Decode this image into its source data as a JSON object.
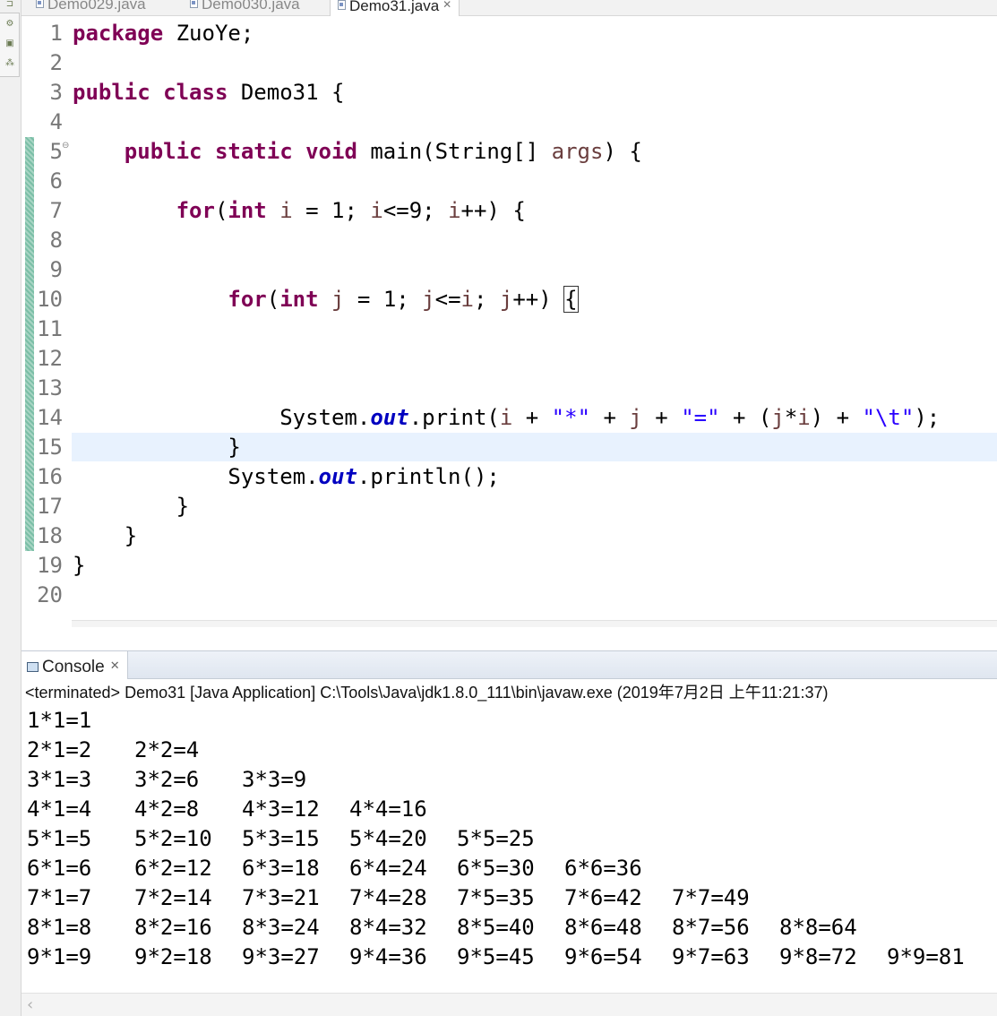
{
  "editor_tabs": [
    {
      "label": "Demo029.java",
      "active": false
    },
    {
      "label": "Demo030.java",
      "active": false
    },
    {
      "label": "Demo31.java",
      "active": true
    }
  ],
  "code_lines": [
    {
      "num": "1",
      "tokens": [
        {
          "t": "kw",
          "v": "package"
        },
        {
          "t": "",
          "v": " ZuoYe;"
        }
      ]
    },
    {
      "num": "2",
      "tokens": []
    },
    {
      "num": "3",
      "tokens": [
        {
          "t": "kw",
          "v": "public"
        },
        {
          "t": "",
          "v": " "
        },
        {
          "t": "kw",
          "v": "class"
        },
        {
          "t": "",
          "v": " Demo31 {"
        }
      ]
    },
    {
      "num": "4",
      "tokens": []
    },
    {
      "num": "5",
      "fold": true,
      "tokens": [
        {
          "t": "",
          "v": "    "
        },
        {
          "t": "kw",
          "v": "public"
        },
        {
          "t": "",
          "v": " "
        },
        {
          "t": "kw",
          "v": "static"
        },
        {
          "t": "",
          "v": " "
        },
        {
          "t": "kw",
          "v": "void"
        },
        {
          "t": "",
          "v": " main(String[] "
        },
        {
          "t": "var",
          "v": "args"
        },
        {
          "t": "",
          "v": ") {"
        }
      ]
    },
    {
      "num": "6",
      "tokens": []
    },
    {
      "num": "7",
      "tokens": [
        {
          "t": "",
          "v": "        "
        },
        {
          "t": "kw",
          "v": "for"
        },
        {
          "t": "",
          "v": "("
        },
        {
          "t": "kw",
          "v": "int"
        },
        {
          "t": "",
          "v": " "
        },
        {
          "t": "var",
          "v": "i"
        },
        {
          "t": "",
          "v": " = 1; "
        },
        {
          "t": "var",
          "v": "i"
        },
        {
          "t": "",
          "v": "<=9; "
        },
        {
          "t": "var",
          "v": "i"
        },
        {
          "t": "",
          "v": "++) {"
        }
      ]
    },
    {
      "num": "8",
      "tokens": []
    },
    {
      "num": "9",
      "tokens": []
    },
    {
      "num": "10",
      "tokens": [
        {
          "t": "",
          "v": "            "
        },
        {
          "t": "kw",
          "v": "for"
        },
        {
          "t": "",
          "v": "("
        },
        {
          "t": "kw",
          "v": "int"
        },
        {
          "t": "",
          "v": " "
        },
        {
          "t": "var",
          "v": "j"
        },
        {
          "t": "",
          "v": " = 1; "
        },
        {
          "t": "var",
          "v": "j"
        },
        {
          "t": "",
          "v": "<="
        },
        {
          "t": "var",
          "v": "i"
        },
        {
          "t": "",
          "v": "; "
        },
        {
          "t": "var",
          "v": "j"
        },
        {
          "t": "",
          "v": "++) "
        },
        {
          "t": "match",
          "v": "{"
        }
      ]
    },
    {
      "num": "11",
      "tokens": []
    },
    {
      "num": "12",
      "tokens": []
    },
    {
      "num": "13",
      "tokens": []
    },
    {
      "num": "14",
      "tokens": [
        {
          "t": "",
          "v": "                System."
        },
        {
          "t": "fld",
          "v": "out"
        },
        {
          "t": "",
          "v": ".print("
        },
        {
          "t": "var",
          "v": "i"
        },
        {
          "t": "",
          "v": " + "
        },
        {
          "t": "str",
          "v": "\"*\""
        },
        {
          "t": "",
          "v": " + "
        },
        {
          "t": "var",
          "v": "j"
        },
        {
          "t": "",
          "v": " + "
        },
        {
          "t": "str",
          "v": "\"=\""
        },
        {
          "t": "",
          "v": " + ("
        },
        {
          "t": "var",
          "v": "j"
        },
        {
          "t": "",
          "v": "*"
        },
        {
          "t": "var",
          "v": "i"
        },
        {
          "t": "",
          "v": ") + "
        },
        {
          "t": "str",
          "v": "\"\\t\""
        },
        {
          "t": "",
          "v": ");"
        }
      ]
    },
    {
      "num": "15",
      "tokens": [
        {
          "t": "",
          "v": "            }"
        }
      ]
    },
    {
      "num": "16",
      "tokens": [
        {
          "t": "",
          "v": "            System."
        },
        {
          "t": "fld",
          "v": "out"
        },
        {
          "t": "",
          "v": ".println();"
        }
      ]
    },
    {
      "num": "17",
      "tokens": [
        {
          "t": "",
          "v": "        }"
        }
      ]
    },
    {
      "num": "18",
      "tokens": [
        {
          "t": "",
          "v": "    }"
        }
      ]
    },
    {
      "num": "19",
      "tokens": [
        {
          "t": "",
          "v": "}"
        }
      ]
    },
    {
      "num": "20",
      "tokens": []
    }
  ],
  "console": {
    "tab_label": "Console",
    "status": "<terminated> Demo31 [Java Application] C:\\Tools\\Java\\jdk1.8.0_111\\bin\\javaw.exe (2019年7月2日 上午11:21:37)",
    "output_lines": [
      [
        "1*1=1"
      ],
      [
        "2*1=2",
        "2*2=4"
      ],
      [
        "3*1=3",
        "3*2=6",
        "3*3=9"
      ],
      [
        "4*1=4",
        "4*2=8",
        "4*3=12",
        "4*4=16"
      ],
      [
        "5*1=5",
        "5*2=10",
        "5*3=15",
        "5*4=20",
        "5*5=25"
      ],
      [
        "6*1=6",
        "6*2=12",
        "6*3=18",
        "6*4=24",
        "6*5=30",
        "6*6=36"
      ],
      [
        "7*1=7",
        "7*2=14",
        "7*3=21",
        "7*4=28",
        "7*5=35",
        "7*6=42",
        "7*7=49"
      ],
      [
        "8*1=8",
        "8*2=16",
        "8*3=24",
        "8*4=32",
        "8*5=40",
        "8*6=48",
        "8*7=56",
        "8*8=64"
      ],
      [
        "9*1=9",
        "9*2=18",
        "9*3=27",
        "9*4=36",
        "9*5=45",
        "9*6=54",
        "9*7=63",
        "9*8=72",
        "9*9=81"
      ]
    ]
  },
  "icons": {
    "left_strip": [
      "pin-icon",
      "hierarchy-icon",
      "package-icon",
      "outline-icon"
    ],
    "scroll_left": "‹"
  }
}
